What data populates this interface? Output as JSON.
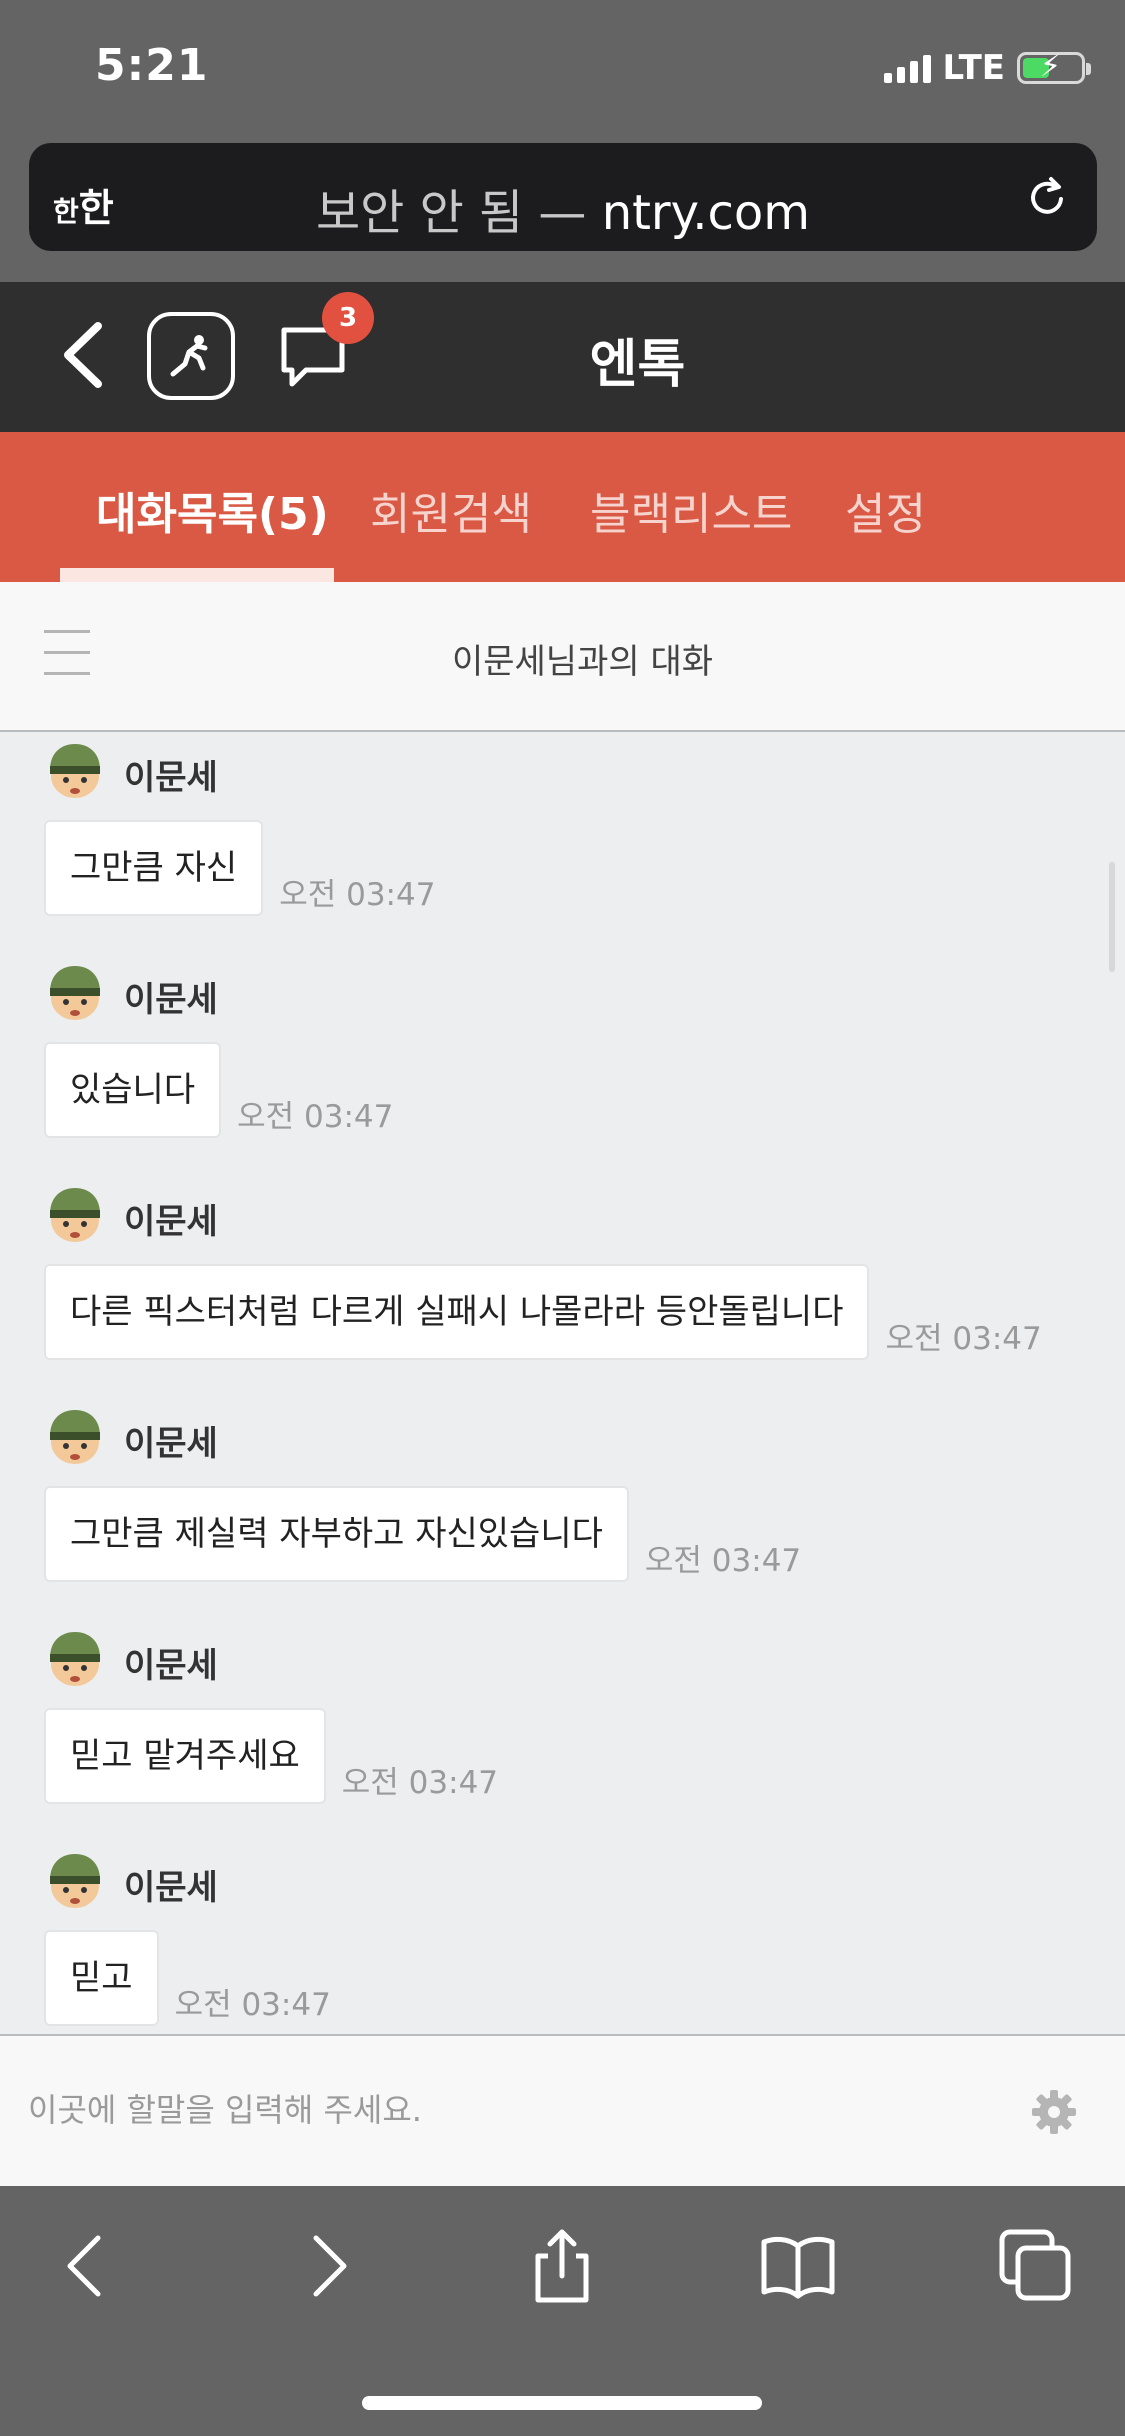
{
  "status": {
    "time": "5:21",
    "network": "LTE"
  },
  "url_bar": {
    "reader_label": "한",
    "reader_label_big": "한",
    "security_text": "보안 안 됨 —",
    "domain": "ntry.com"
  },
  "app": {
    "title": "엔톡",
    "chat_badge": "3"
  },
  "tabs": [
    {
      "label": "대화목록(5)"
    },
    {
      "label": "회원검색"
    },
    {
      "label": "블랙리스트"
    },
    {
      "label": "설정"
    }
  ],
  "conversation": {
    "title": "이문세님과의 대화"
  },
  "messages": [
    {
      "sender": "이문세",
      "text": "그만큼 자신",
      "time": "오전 03:47"
    },
    {
      "sender": "이문세",
      "text": "있습니다",
      "time": "오전 03:47"
    },
    {
      "sender": "이문세",
      "text": "다른 픽스터처럼 다르게 실패시 나몰라라 등안돌립니다",
      "time": "오전 03:47"
    },
    {
      "sender": "이문세",
      "text": "그만큼 제실력 자부하고 자신있습니다",
      "time": "오전 03:47"
    },
    {
      "sender": "이문세",
      "text": "믿고 맡겨주세요",
      "time": "오전 03:47"
    },
    {
      "sender": "이문세",
      "text": "믿고",
      "time": "오전 03:47"
    }
  ],
  "composer": {
    "placeholder": "이곳에 할말을 입력해 주세요."
  },
  "colors": {
    "tab_bar": "#d95945",
    "header": "#2f2f2f",
    "badge": "#e2513f",
    "chat_bg": "#eceef0"
  }
}
